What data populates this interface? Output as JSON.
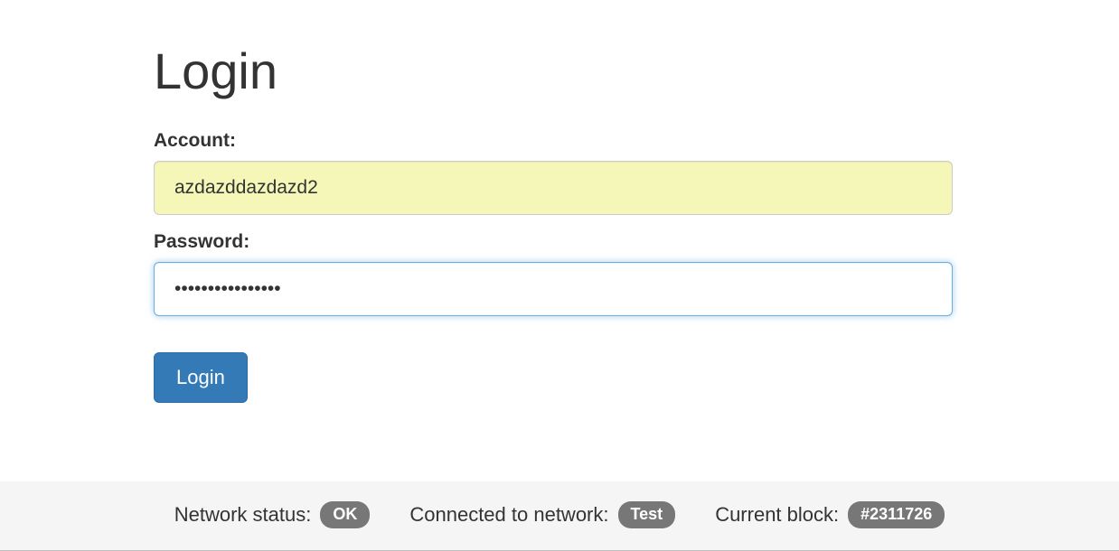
{
  "title": "Login",
  "form": {
    "account_label": "Account:",
    "account_value": "azdazddazdazd2",
    "password_label": "Password:",
    "password_value": "••••••••••••••••",
    "login_button": "Login"
  },
  "footer": {
    "network_status_label": "Network status:",
    "network_status_value": "OK",
    "connected_label": "Connected to network:",
    "connected_value": "Test",
    "block_label": "Current block:",
    "block_value": "#2311726"
  }
}
